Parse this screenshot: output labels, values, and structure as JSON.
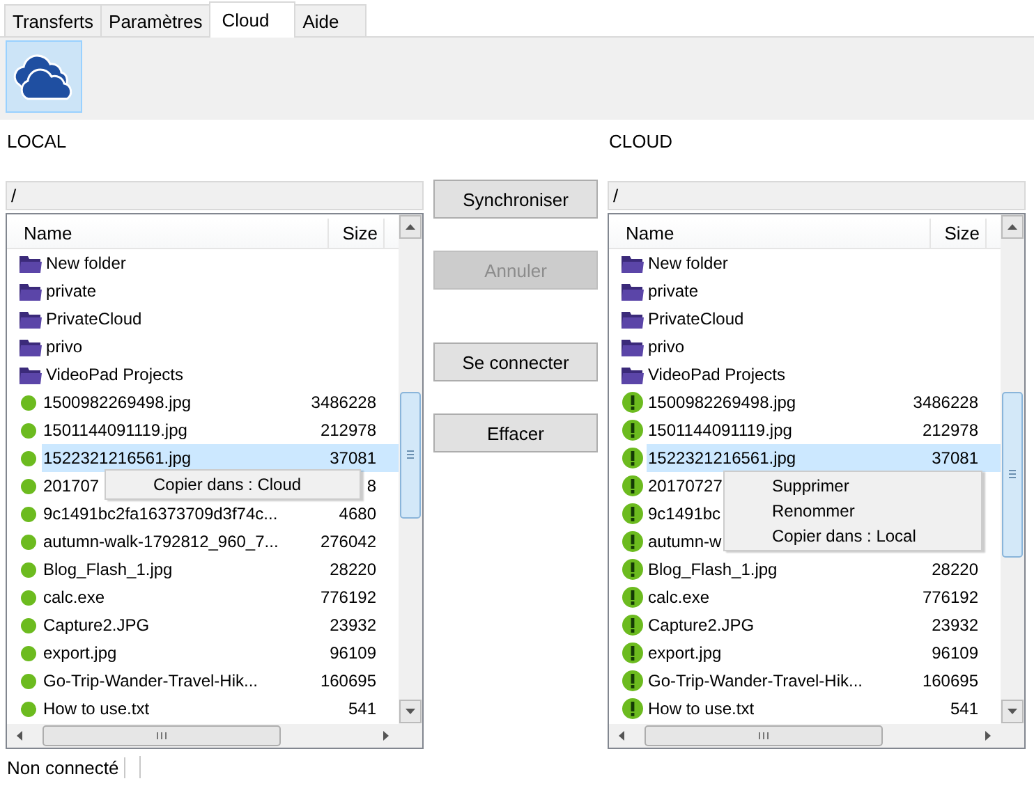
{
  "tabs": [
    {
      "label": "Transferts",
      "selected": false
    },
    {
      "label": "Paramètres",
      "selected": false
    },
    {
      "label": "Cloud",
      "selected": true
    },
    {
      "label": "Aide",
      "selected": false
    }
  ],
  "toolbar": {
    "cloud_button": {
      "selected": true
    }
  },
  "panes": [
    {
      "title": "LOCAL",
      "path": "/",
      "columns": [
        "Name",
        "Size"
      ],
      "items": [
        {
          "kind": "folder",
          "name": "New folder",
          "selected": false
        },
        {
          "kind": "folder",
          "name": "private",
          "selected": false
        },
        {
          "kind": "folder",
          "name": "PrivateCloud",
          "selected": false
        },
        {
          "kind": "folder",
          "name": "privo",
          "selected": false
        },
        {
          "kind": "folder",
          "name": "VideoPad Projects",
          "selected": false
        },
        {
          "kind": "synced",
          "name": "1500982269498.jpg",
          "size": "3486228",
          "selected": false
        },
        {
          "kind": "synced",
          "name": "1501144091119.jpg",
          "size": "212978",
          "selected": false
        },
        {
          "kind": "synced",
          "name": "1522321216561.jpg",
          "size": "37081",
          "selected": true
        },
        {
          "kind": "synced",
          "name": "201707",
          "size": "8",
          "selected": false
        },
        {
          "kind": "synced",
          "name": "9c1491bc2fa16373709d3f74c...",
          "size": "4680",
          "selected": false
        },
        {
          "kind": "synced",
          "name": "autumn-walk-1792812_960_7...",
          "size": "276042",
          "selected": false
        },
        {
          "kind": "synced",
          "name": "Blog_Flash_1.jpg",
          "size": "28220",
          "selected": false
        },
        {
          "kind": "synced",
          "name": "calc.exe",
          "size": "776192",
          "selected": false
        },
        {
          "kind": "synced",
          "name": "Capture2.JPG",
          "size": "23932",
          "selected": false
        },
        {
          "kind": "synced",
          "name": "export.jpg",
          "size": "96109",
          "selected": false
        },
        {
          "kind": "synced",
          "name": "Go-Trip-Wander-Travel-Hik...",
          "size": "160695",
          "selected": false
        },
        {
          "kind": "synced",
          "name": "How to use.txt",
          "size": "541",
          "selected": false
        }
      ],
      "context_menu": [
        "Copier dans : Cloud"
      ]
    },
    {
      "title": "CLOUD",
      "path": "/",
      "columns": [
        "Name",
        "Size"
      ],
      "items": [
        {
          "kind": "folder",
          "name": "New folder",
          "selected": false
        },
        {
          "kind": "folder",
          "name": "private",
          "selected": false
        },
        {
          "kind": "folder",
          "name": "PrivateCloud",
          "selected": false
        },
        {
          "kind": "folder",
          "name": "privo",
          "selected": false
        },
        {
          "kind": "folder",
          "name": "VideoPad Projects",
          "selected": false
        },
        {
          "kind": "pending",
          "name": "1500982269498.jpg",
          "size": "3486228",
          "selected": false
        },
        {
          "kind": "pending",
          "name": "1501144091119.jpg",
          "size": "212978",
          "selected": false
        },
        {
          "kind": "pending",
          "name": "1522321216561.jpg",
          "size": "37081",
          "selected": true
        },
        {
          "kind": "pending",
          "name": "20170727",
          "selected": false
        },
        {
          "kind": "pending",
          "name": "9c1491bc",
          "selected": false
        },
        {
          "kind": "pending",
          "name": "autumn-w",
          "selected": false
        },
        {
          "kind": "pending",
          "name": "Blog_Flash_1.jpg",
          "size": "28220",
          "selected": false
        },
        {
          "kind": "pending",
          "name": "calc.exe",
          "size": "776192",
          "selected": false
        },
        {
          "kind": "pending",
          "name": "Capture2.JPG",
          "size": "23932",
          "selected": false
        },
        {
          "kind": "pending",
          "name": "export.jpg",
          "size": "96109",
          "selected": false
        },
        {
          "kind": "pending",
          "name": "Go-Trip-Wander-Travel-Hik...",
          "size": "160695",
          "selected": false
        },
        {
          "kind": "pending",
          "name": "How to use.txt",
          "size": "541",
          "selected": false
        }
      ],
      "context_menu": [
        "Supprimer",
        "Renommer",
        "Copier dans : Local"
      ]
    }
  ],
  "actions": [
    {
      "label": "Synchroniser",
      "disabled": false
    },
    {
      "label": "Annuler",
      "disabled": true
    },
    {
      "label": "Se connecter",
      "disabled": false
    },
    {
      "label": "Effacer",
      "disabled": false
    }
  ],
  "status_bar": [
    "Non connecté"
  ]
}
